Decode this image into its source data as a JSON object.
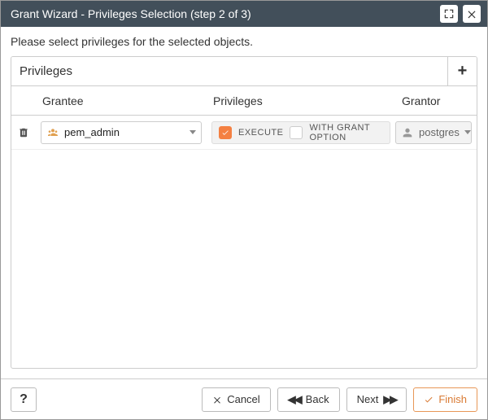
{
  "title": "Grant Wizard - Privileges Selection (step 2 of 3)",
  "instruction": "Please select privileges for the selected objects.",
  "section": {
    "title": "Privileges",
    "columns": {
      "grantee": "Grantee",
      "privileges": "Privileges",
      "grantor": "Grantor"
    }
  },
  "row": {
    "grantee": "pem_admin",
    "priv_execute_label": "EXECUTE",
    "priv_execute_checked": true,
    "priv_wgo_label": "WITH GRANT OPTION",
    "priv_wgo_checked": false,
    "grantor": "postgres"
  },
  "footer": {
    "help": "?",
    "cancel": "Cancel",
    "back": "Back",
    "next": "Next",
    "finish": "Finish"
  }
}
